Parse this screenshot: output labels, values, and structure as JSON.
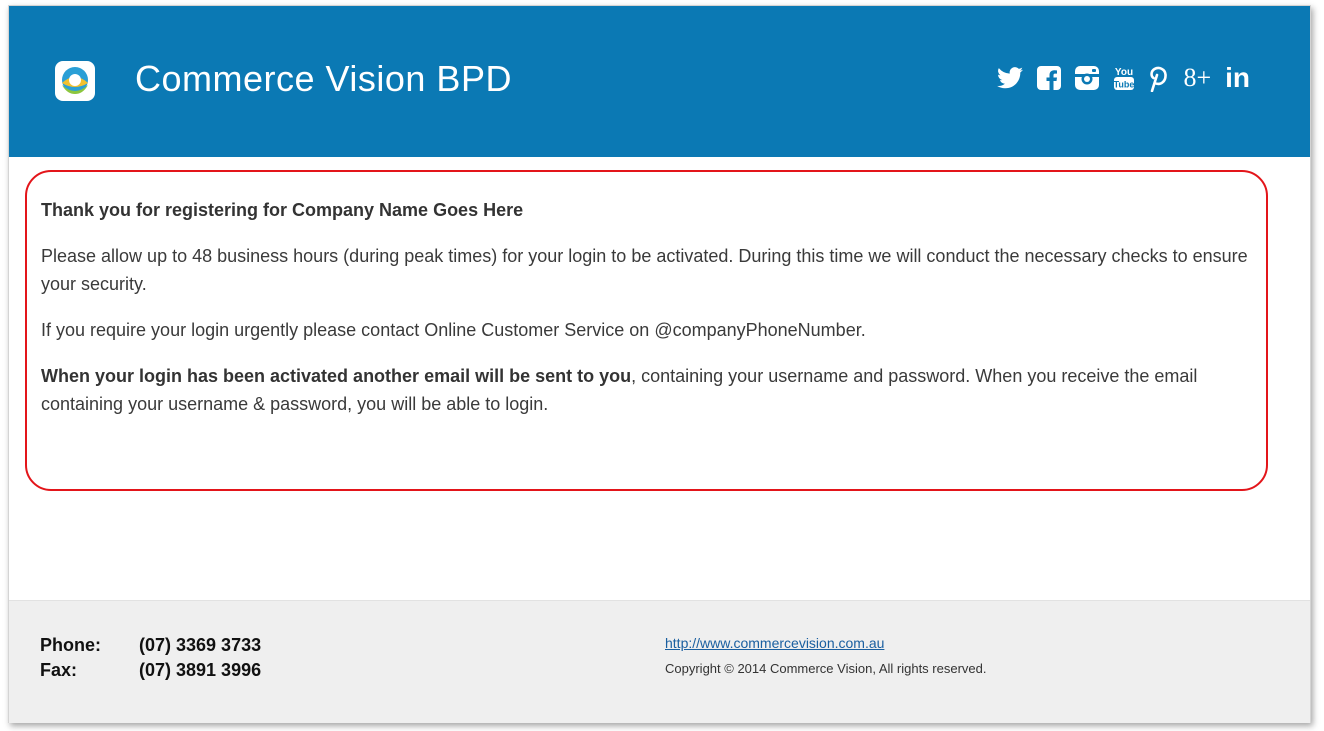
{
  "header": {
    "brand": "Commerce Vision BPD",
    "social": [
      {
        "name": "twitter-icon"
      },
      {
        "name": "facebook-icon"
      },
      {
        "name": "instagram-icon"
      },
      {
        "name": "youtube-icon",
        "text_top": "You",
        "text_bottom": "Tube"
      },
      {
        "name": "pinterest-icon",
        "glyph": "𝓅"
      },
      {
        "name": "google-plus-icon",
        "glyph": "8+"
      },
      {
        "name": "linkedin-icon",
        "glyph": "in"
      }
    ]
  },
  "content": {
    "title": "Thank you for registering for Company Name Goes Here",
    "p1": "Please allow up to 48 business hours (during peak times) for your login to be activated. During this time we will conduct the necessary checks to ensure your security.",
    "p2": "If you require your login urgently please contact Online Customer Service on @companyPhoneNumber.",
    "p3_bold": "When your login has been activated another email will be sent to you",
    "p3_rest": ", containing your username and password. When you receive the email containing your username & password, you will be able to login."
  },
  "footer": {
    "phone_label": "Phone:",
    "phone_value": "(07) 3369 3733",
    "fax_label": "Fax:",
    "fax_value": "(07) 3891 3996",
    "website": "http://www.commercevision.com.au",
    "copyright": "Copyright © 2014 Commerce Vision, All rights reserved."
  },
  "colors": {
    "header_bg": "#0b79b4",
    "highlight_border": "#e3151a",
    "footer_bg": "#efefef"
  }
}
